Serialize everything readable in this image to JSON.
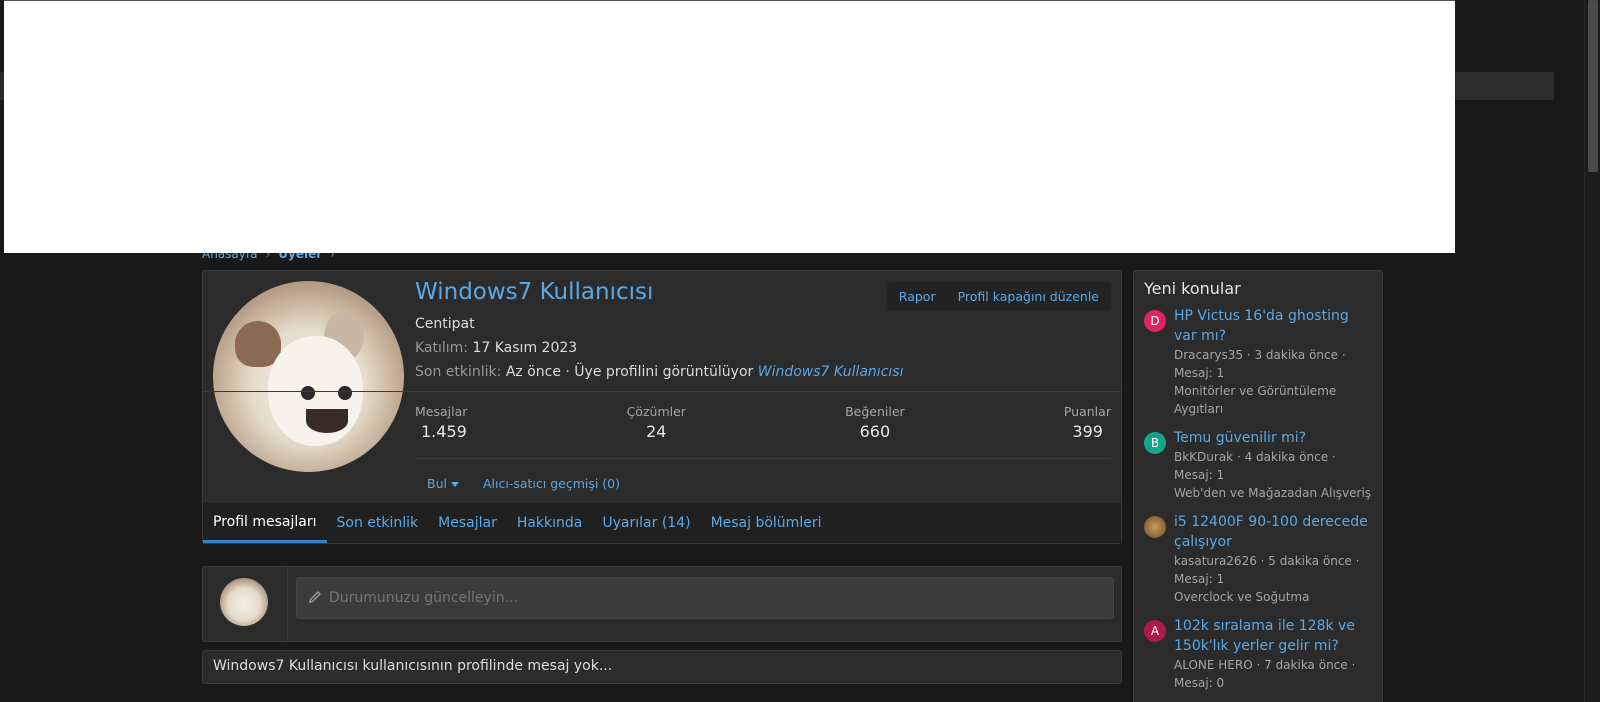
{
  "breadcrumb": {
    "home": "Anasayfa",
    "members": "Üyeler"
  },
  "profile": {
    "username": "Windows7 Kullanıcısı",
    "title": "Centipat",
    "joined_label": "Katılım:",
    "joined_value": "17 Kasım 2023",
    "last_label": "Son etkinlik:",
    "last_value": "Az önce · Üye profilini görüntülüyor",
    "last_link": "Windows7 Kullanıcısı",
    "buttons": {
      "report": "Rapor",
      "edit_cover": "Profil kapağını düzenle"
    },
    "stats": [
      {
        "label": "Mesajlar",
        "value": "1.459"
      },
      {
        "label": "Çözümler",
        "value": "24"
      },
      {
        "label": "Beğeniler",
        "value": "660"
      },
      {
        "label": "Puanlar",
        "value": "399"
      }
    ],
    "actions": {
      "find": "Bul",
      "trader": "Alıcı-satıcı geçmişi (0)"
    },
    "tabs": [
      {
        "label": "Profil mesajları",
        "active": true
      },
      {
        "label": "Son etkinlik"
      },
      {
        "label": "Mesajlar"
      },
      {
        "label": "Hakkında"
      },
      {
        "label": "Uyarılar (14)"
      },
      {
        "label": "Mesaj bölümleri"
      }
    ]
  },
  "status": {
    "placeholder": "Durumunuzu güncelleyin..."
  },
  "no_messages": "Windows7 Kullanıcısı kullanıcısının profilinde mesaj yok...",
  "sidebar": {
    "title": "Yeni konular",
    "threads": [
      {
        "avatar": "D",
        "color": "#e0245e",
        "title": "HP Victus 16'da ghosting var mı?",
        "meta": "Dracarys35 · 3 dakika önce · Mesaj: 1",
        "forum": "Monitörler ve Görüntüleme Aygıtları"
      },
      {
        "avatar": "B",
        "color": "#17a589",
        "title": "Temu güvenilir mi?",
        "meta": "BkKDurak · 4 dakika önce · Mesaj: 1",
        "forum": "Web'den ve Mağazadan Alışveriş"
      },
      {
        "avatar": "",
        "color": "#8a6a3a",
        "title": "i5 12400F 90-100 derecede çalışıyor",
        "meta": "kasatura2626 · 5 dakika önce · Mesaj: 1",
        "forum": "Overclock ve Soğutma"
      },
      {
        "avatar": "A",
        "color": "#b0174a",
        "title": "102k sıralama ile 128k ve 150k'lık yerler gelir mi?",
        "meta": "ALONE HERO · 7 dakika önce · Mesaj: 0",
        "forum": ""
      }
    ]
  }
}
